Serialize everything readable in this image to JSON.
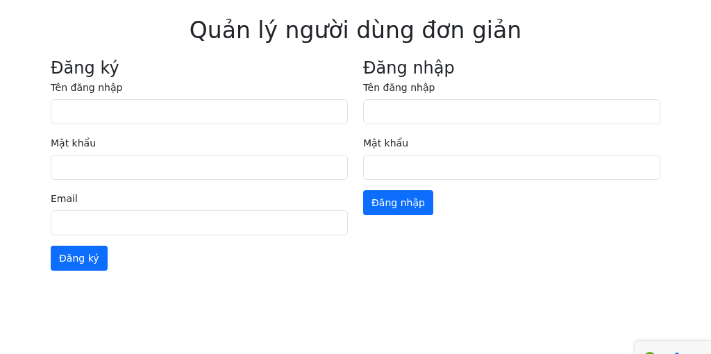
{
  "title": "Quản lý người dùng đơn giản",
  "forms": [
    {
      "heading": "Đăng ký",
      "fields": [
        {
          "label": "Tên đăng nhập"
        },
        {
          "label": "Mật khẩu"
        },
        {
          "label": "Email"
        }
      ],
      "button": "Đăng ký"
    },
    {
      "heading": "Đăng nhập",
      "fields": [
        {
          "label": "Tên đăng nhập"
        },
        {
          "label": "Mật khẩu"
        }
      ],
      "button": "Đăng nhập"
    }
  ]
}
